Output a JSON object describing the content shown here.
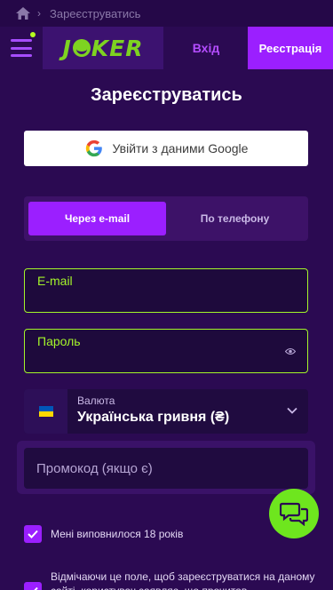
{
  "breadcrumb": {
    "current": "Зареєструватись"
  },
  "header": {
    "logo": "JOKER",
    "login_label": "Вхід",
    "register_label": "Реєстрація"
  },
  "page": {
    "title": "Зареєструватись"
  },
  "google": {
    "label": "Увійти з даними Google"
  },
  "tabs": [
    {
      "label": "Через e-mail",
      "active": true
    },
    {
      "label": "По телефону",
      "active": false
    }
  ],
  "form": {
    "email_label": "E-mail",
    "password_label": "Пароль",
    "currency_label": "Валюта",
    "currency_value": "Українська гривня (₴)",
    "promo_placeholder": "Промокод (якщо є)"
  },
  "consents": {
    "age_label": "Мені виповнилося 18 років",
    "terms_label": "Відмічаючи це поле, щоб зареєструватися на даному сайті, користувач заявляє, що прочитав"
  },
  "colors": {
    "background": "#2b0a52",
    "accent_purple": "#9b1fff",
    "accent_green": "#a4f52a",
    "chat_green": "#6ee61e"
  },
  "icons": {
    "breadcrumb": "home-icon",
    "menu": "hamburger-icon",
    "password": "eye-icon",
    "currency": "chevron-down-icon",
    "chat": "chat-bubbles-icon"
  }
}
